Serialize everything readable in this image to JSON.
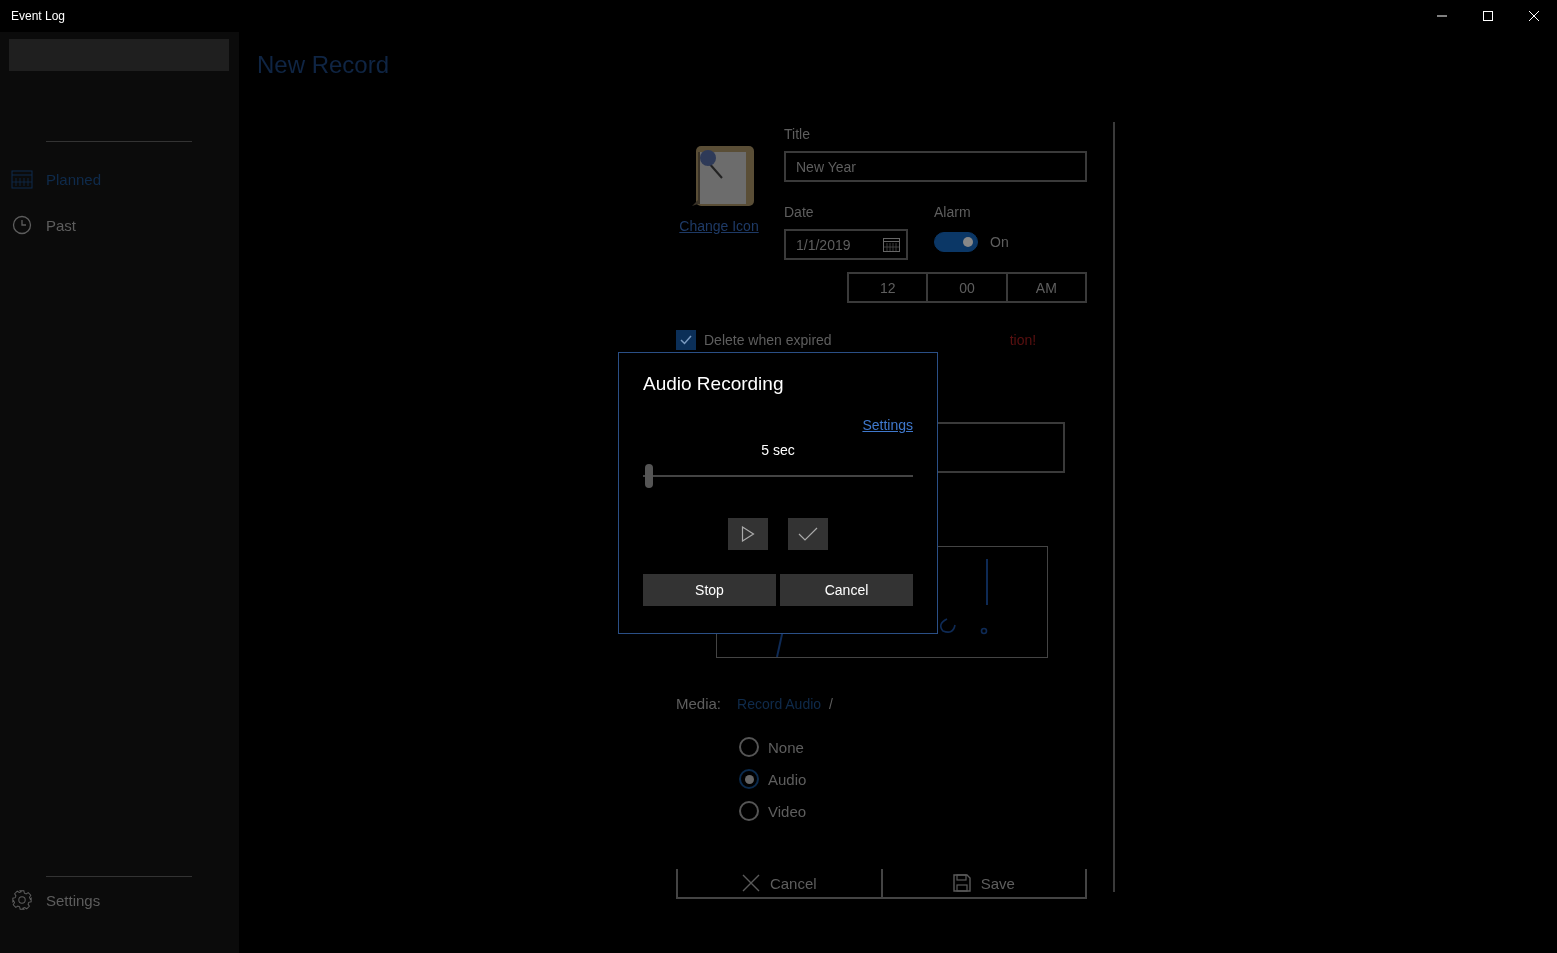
{
  "window": {
    "title": "Event Log"
  },
  "sidebar": {
    "items": [
      {
        "label": "Planned",
        "kind": "calendar",
        "selected": true
      },
      {
        "label": "Past",
        "kind": "clock",
        "selected": false
      }
    ],
    "footer_item": {
      "label": "Settings"
    }
  },
  "page": {
    "title": "New Record"
  },
  "form": {
    "change_icon_link": "Change Icon",
    "title_label": "Title",
    "title_value": "New Year",
    "date_label": "Date",
    "date_value": "1/1/2019",
    "alarm_label": "Alarm",
    "alarm": {
      "on": true,
      "state_text": "On"
    },
    "time": [
      "12",
      "00",
      "AM"
    ],
    "delete_when_expired": {
      "label": "Delete when expired",
      "checked": true
    },
    "warning": "tion!",
    "media_label": "Media:",
    "media_links": [
      "Record Audio",
      "/"
    ],
    "media_options": [
      {
        "label": "None",
        "selected": false
      },
      {
        "label": "Audio",
        "selected": true
      },
      {
        "label": "Video",
        "selected": false
      }
    ],
    "buttons": [
      {
        "kind": "cancel",
        "label": "Cancel"
      },
      {
        "kind": "save",
        "label": "Save"
      }
    ]
  },
  "dialog": {
    "title": "Audio Recording",
    "settings_link": "Settings",
    "duration": "5 sec",
    "level": 0,
    "buttons": [
      "Stop",
      "Cancel"
    ]
  }
}
